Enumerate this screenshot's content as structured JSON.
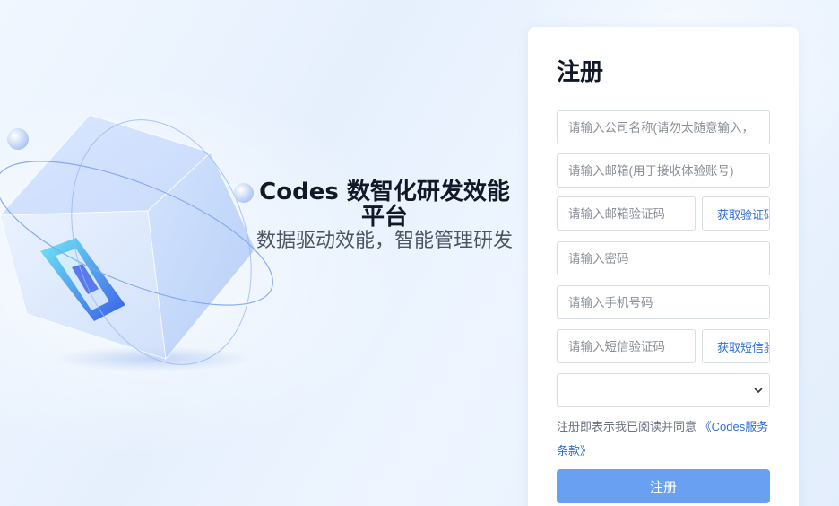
{
  "hero": {
    "title": "Codes 数智化研发效能平台",
    "subtitle": "数据驱动效能，智能管理研发"
  },
  "register": {
    "title": "注册",
    "company_placeholder": "请输入公司名称(请勿太随意输入，",
    "email_placeholder": "请输入邮箱(用于接收体验账号)",
    "email_code_placeholder": "请输入邮箱验证码",
    "get_email_code_label": "获取验证码",
    "password_placeholder": "请输入密码",
    "phone_placeholder": "请输入手机号码",
    "sms_code_placeholder": "请输入短信验证码",
    "get_sms_code_label": "获取短信验证码",
    "terms_prefix": "注册即表示我已阅读并同意",
    "terms_link": "《Codes服务条款》",
    "submit_label": "注册"
  },
  "colors": {
    "accent": "#2f6fd6",
    "submit_bg": "#6aa0f2"
  }
}
